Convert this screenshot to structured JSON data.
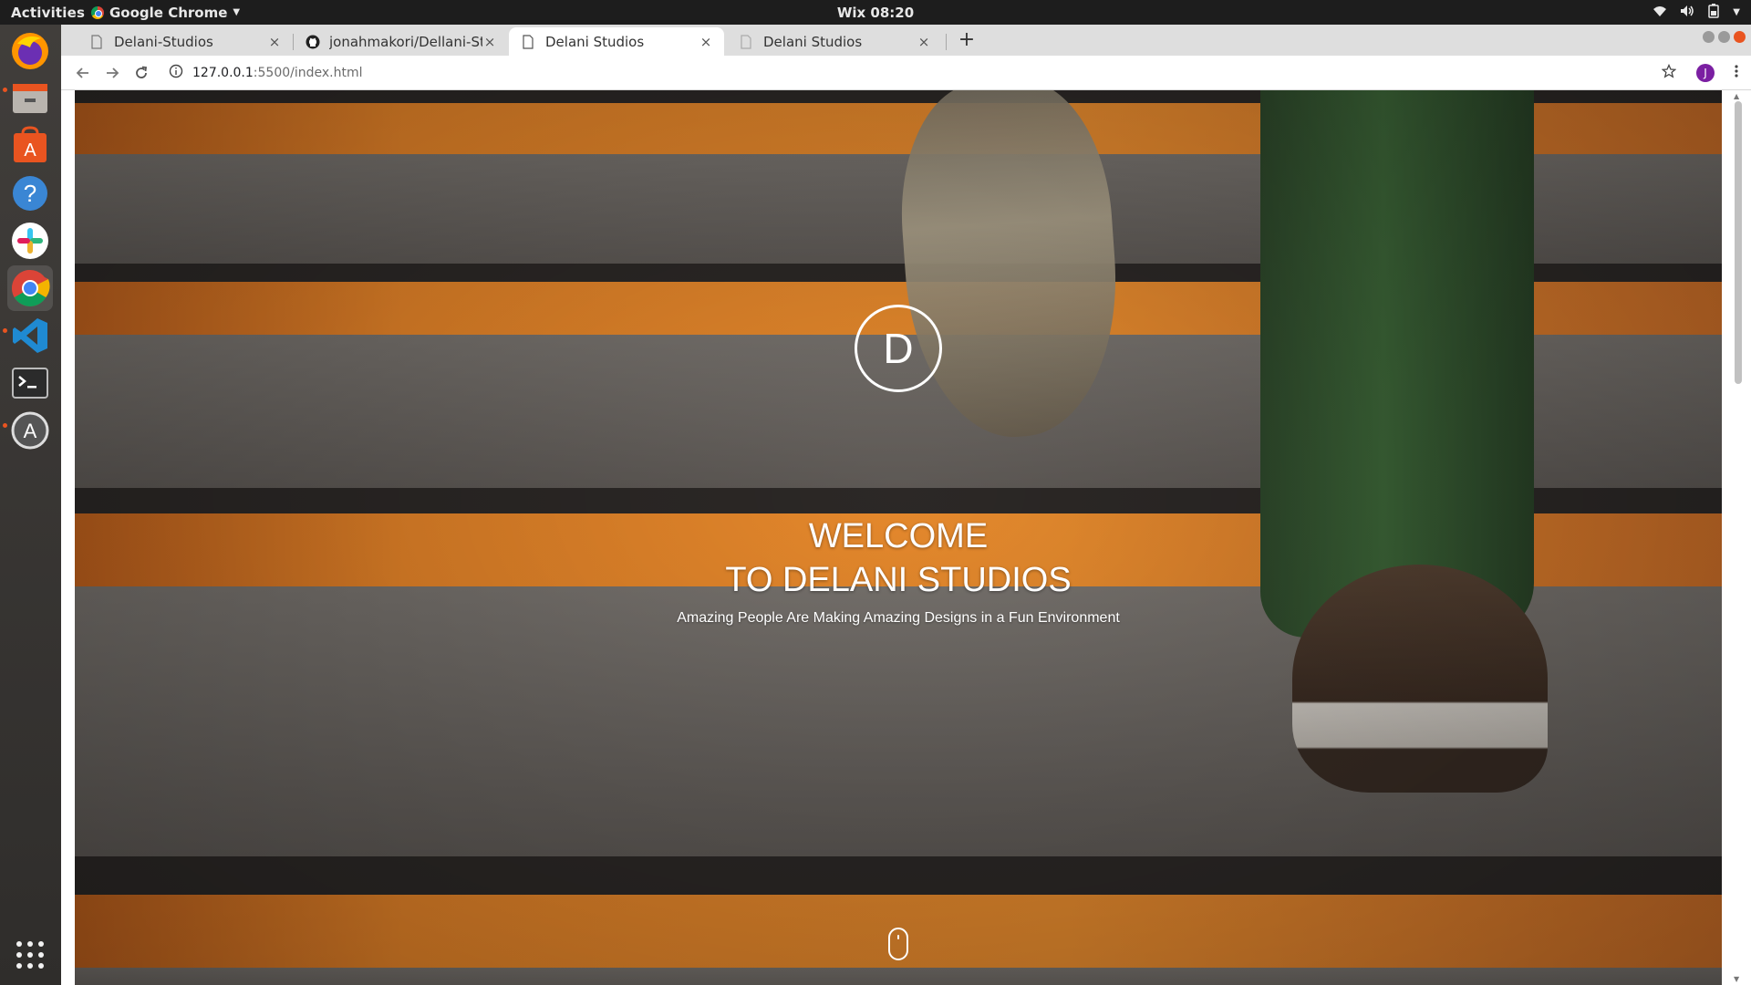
{
  "system": {
    "activities": "Activities",
    "app_name": "Google Chrome",
    "clock": "Wix 08:20"
  },
  "browser": {
    "tabs": [
      {
        "title": "Delani-Studios",
        "icon": "page-icon",
        "active": false
      },
      {
        "title": "jonahmakori/Dellani-Stu",
        "icon": "github-icon",
        "active": false
      },
      {
        "title": "Delani Studios",
        "icon": "page-icon",
        "active": true
      },
      {
        "title": "Delani Studios",
        "icon": "page-icon",
        "active": false
      }
    ],
    "close_glyph": "×",
    "new_tab": "+",
    "url_host": "127.0.0.1",
    "url_path": ":5500/index.html",
    "avatar_letter": "J"
  },
  "page": {
    "logo_letter": "D",
    "title_line1": "WELCOME",
    "title_line2": "TO DELANI STUDIOS",
    "subtitle": "Amazing People Are Making Amazing Designs in a Fun Environment"
  },
  "dock": {
    "items": [
      "firefox-icon",
      "files-icon",
      "software-center-icon",
      "help-icon",
      "slack-icon",
      "chrome-icon",
      "vscode-icon",
      "terminal-icon",
      "software-updater-icon",
      "show-apps-icon"
    ]
  },
  "colors": {
    "accent_orange": "#e95420",
    "stair_orange": "#f29230",
    "avatar": "#7b1fa2"
  }
}
